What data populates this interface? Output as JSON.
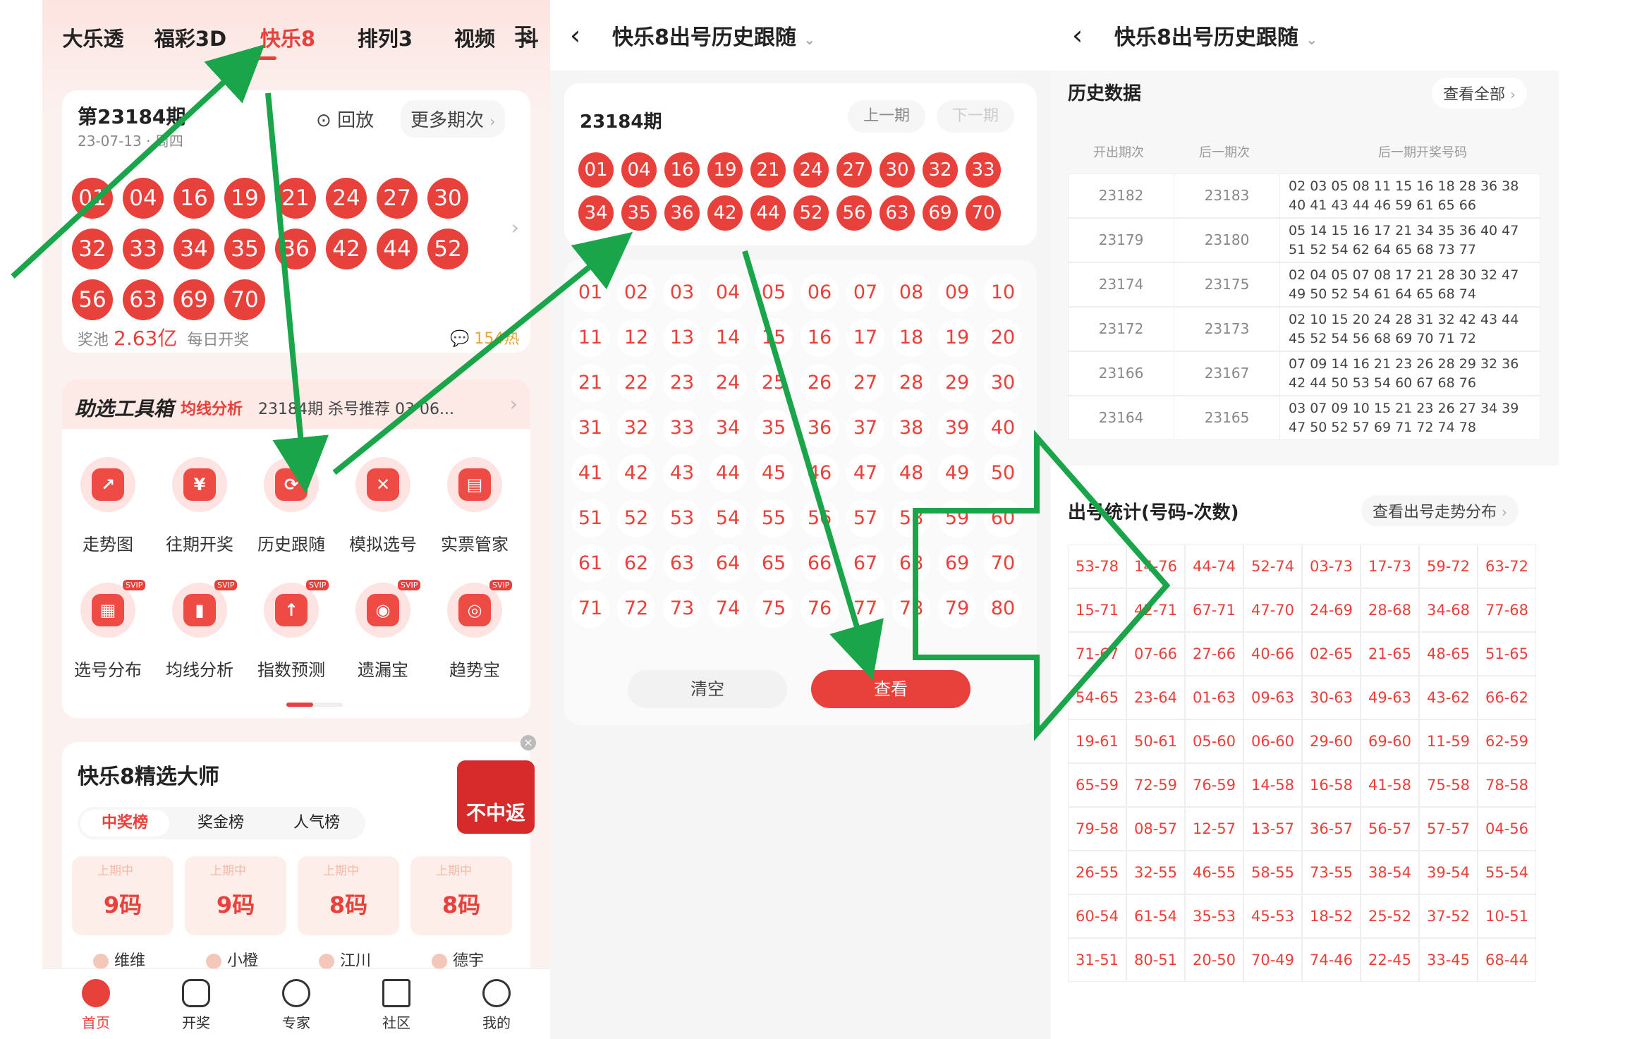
{
  "p1": {
    "tabs": [
      "大乐透",
      "福彩3D",
      "快乐8",
      "排列3",
      "视频",
      "抖"
    ],
    "issue": "第23184期",
    "date": "23-07-13 · 周四",
    "replay": "回放",
    "more": "更多期次",
    "balls": [
      "01",
      "04",
      "16",
      "19",
      "21",
      "24",
      "27",
      "30",
      "32",
      "33",
      "34",
      "35",
      "36",
      "42",
      "44",
      "52",
      "56",
      "63",
      "69",
      "70"
    ],
    "pool_label": "奖池",
    "pool_value": "2.63亿",
    "daily": "每日开奖",
    "hot": "154热",
    "toolbox": "助选工具箱",
    "ticker_tag": "均线分析",
    "ticker_text": "23184期 杀号推荐 03 06...",
    "tools": [
      "走势图",
      "往期开奖",
      "历史跟随",
      "模拟选号",
      "实票管家",
      "选号分布",
      "均线分析",
      "指数预测",
      "遗漏宝",
      "趋势宝"
    ],
    "svip": "SVIP",
    "master_title": "快乐8精选大师",
    "promo": "不中返",
    "rank_tabs": [
      "中奖榜",
      "奖金榜",
      "人气榜"
    ],
    "rank_tag": "上期中",
    "rank_vals": [
      "9码",
      "9码",
      "8码",
      "8码"
    ],
    "rank_names": [
      "维维",
      "小橙",
      "江川",
      "德宇"
    ],
    "nav": [
      "首页",
      "开奖",
      "专家",
      "社区",
      "我的"
    ]
  },
  "p2": {
    "title": "快乐8出号历史跟随",
    "issue": "23184期",
    "prev": "上一期",
    "next": "下一期",
    "balls": [
      "01",
      "04",
      "16",
      "19",
      "21",
      "24",
      "27",
      "30",
      "32",
      "33",
      "34",
      "35",
      "36",
      "42",
      "44",
      "52",
      "56",
      "63",
      "69",
      "70"
    ],
    "clear": "清空",
    "view": "查看"
  },
  "p3": {
    "title": "快乐8出号历史跟随",
    "hist_title": "历史数据",
    "view_all": "查看全部",
    "cols": [
      "开出期次",
      "后一期次",
      "后一期开奖号码"
    ],
    "rows": [
      [
        "23182",
        "23183",
        "02 03 05 08 11 15 16 18 28 36 38",
        "40 41 43 44 46 59 61 65 66"
      ],
      [
        "23179",
        "23180",
        "05 14 15 16 17 21 34 35 36 40 47",
        "51 52 54 62 64 65 68 73 77"
      ],
      [
        "23174",
        "23175",
        "02 04 05 07 08 17 21 28 30 32 47",
        "49 50 52 54 61 64 65 68 74"
      ],
      [
        "23172",
        "23173",
        "02 10 15 20 24 28 31 32 42 43 44",
        "45 52 54 56 68 69 70 71 72"
      ],
      [
        "23166",
        "23167",
        "07 09 14 16 21 23 26 28 29 32 36",
        "42 44 50 53 54 60 67 68 76"
      ],
      [
        "23164",
        "23165",
        "03 07 09 10 15 21 23 26 27 34 39",
        "47 50 52 57 69 71 72 74 78"
      ]
    ],
    "stat_title": "出号统计(号码-次数)",
    "stat_link": "查看出号走势分布",
    "stats": [
      "53-78",
      "14-76",
      "44-74",
      "52-74",
      "03-73",
      "17-73",
      "59-72",
      "63-72",
      "15-71",
      "42-71",
      "67-71",
      "47-70",
      "24-69",
      "28-68",
      "34-68",
      "77-68",
      "71-67",
      "07-66",
      "27-66",
      "40-66",
      "02-65",
      "21-65",
      "48-65",
      "51-65",
      "54-65",
      "23-64",
      "01-63",
      "09-63",
      "30-63",
      "49-63",
      "43-62",
      "66-62",
      "19-61",
      "50-61",
      "05-60",
      "06-60",
      "29-60",
      "69-60",
      "11-59",
      "62-59",
      "65-59",
      "72-59",
      "76-59",
      "14-58",
      "16-58",
      "41-58",
      "75-58",
      "78-58",
      "79-58",
      "08-57",
      "12-57",
      "13-57",
      "36-57",
      "56-57",
      "57-57",
      "04-56",
      "26-55",
      "32-55",
      "46-55",
      "58-55",
      "73-55",
      "38-54",
      "39-54",
      "55-54",
      "60-54",
      "61-54",
      "35-53",
      "45-53",
      "18-52",
      "25-52",
      "37-52",
      "10-51",
      "31-51",
      "80-51",
      "20-50",
      "70-49",
      "74-46",
      "22-45",
      "33-45",
      "68-44"
    ]
  },
  "colors": {
    "accent": "#e8403b",
    "arrow": "#1aa54a"
  }
}
